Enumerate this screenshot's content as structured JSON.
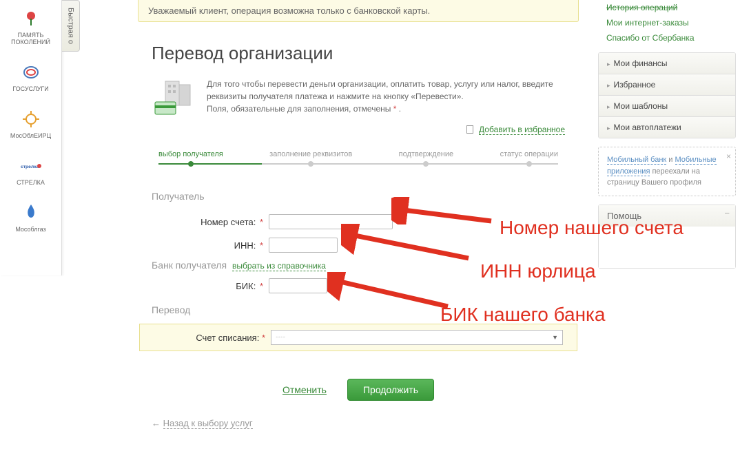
{
  "sidebar": {
    "fast_tab": "Быстрая о",
    "items": [
      {
        "label": "ПАМЯТЬ ПОКОЛЕНИЙ"
      },
      {
        "label": "ГОСУСЛУГИ"
      },
      {
        "label": "МосОблЕИРЦ"
      },
      {
        "label": "СТРЕЛКА"
      },
      {
        "label": "Мособлгаз"
      }
    ]
  },
  "alert": "Уважаемый клиент, операция возможна только с банковской карты.",
  "title": "Перевод организации",
  "intro": {
    "line1": "Для того чтобы перевести деньги организации, оплатить товар, услугу или налог, введите реквизиты получателя платежа и нажмите на кнопку «Перевести».",
    "line2": "Поля, обязательные для заполнения, отмечены ",
    "line2_end": " ."
  },
  "fav_link": "Добавить в избранное",
  "steps": {
    "s1": "выбор получателя",
    "s2": "заполнение реквизитов",
    "s3": "подтверждение",
    "s4": "статус операции"
  },
  "sections": {
    "recipient": "Получатель",
    "bank": "Банк получателя",
    "transfer": "Перевод"
  },
  "fields": {
    "account_label": "Номер счета:",
    "inn_label": "ИНН:",
    "bik_label": "БИК:",
    "bank_select": "выбрать из справочника",
    "debit_label": "Счет списания:",
    "debit_value": "••••"
  },
  "actions": {
    "cancel": "Отменить",
    "continue": "Продолжить",
    "back": "Назад к выбору услуг"
  },
  "right": {
    "top_links": {
      "l0": "История операций",
      "l1": "Мои интернет-заказы",
      "l2": "Спасибо от Сбербанка"
    },
    "accordion": {
      "a1": "Мои финансы",
      "a2": "Избранное",
      "a3": "Мои шаблоны",
      "a4": "Мои автоплатежи"
    },
    "info": {
      "link1": "Мобильный банк",
      "and": " и ",
      "link2": "Мобильные приложения",
      "rest": " переехали на страницу Вашего профиля"
    },
    "help": "Помощь"
  },
  "annotations": {
    "a1": "Номер  нашего счета",
    "a2": "ИНН юрлица",
    "a3": "БИК нашего банка"
  }
}
